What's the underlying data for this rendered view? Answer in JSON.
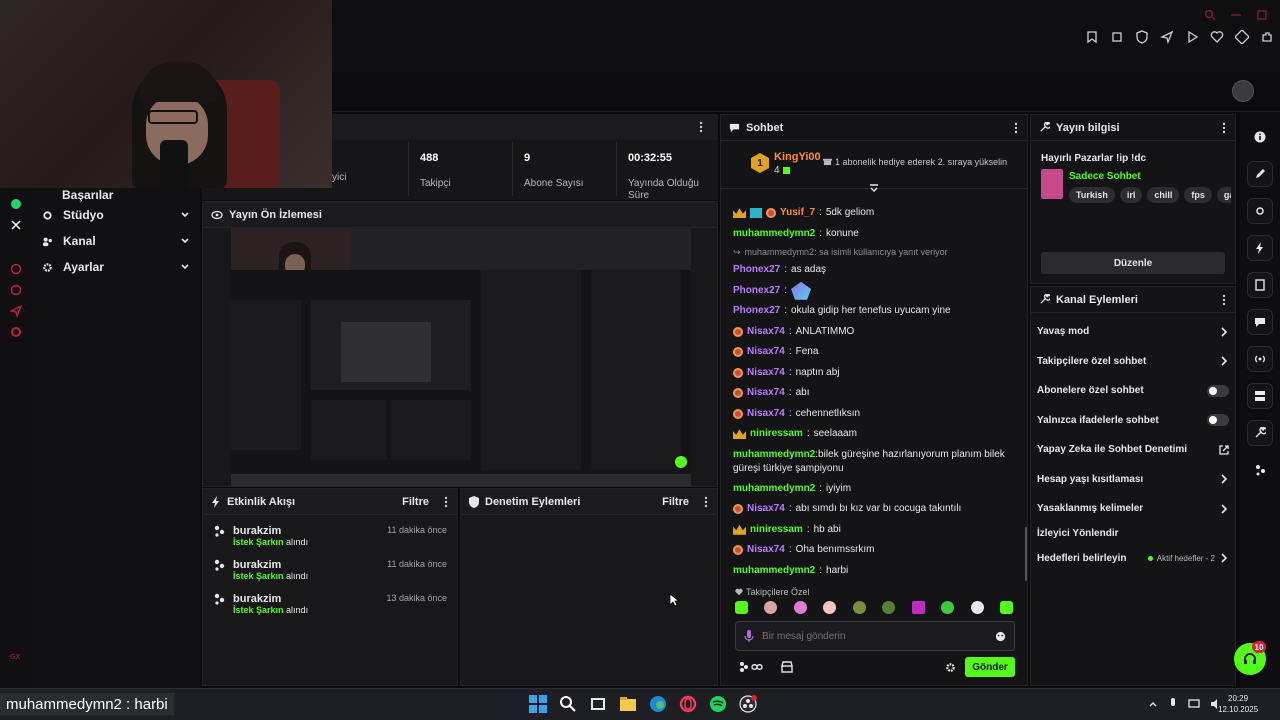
{
  "sidebar": {
    "partial_item": "Başarılar",
    "items": [
      {
        "label": "Stüdyo",
        "icon": "gear-icon"
      },
      {
        "label": "Kanal",
        "icon": "people-icon"
      },
      {
        "label": "Ayarlar",
        "icon": "gear-icon"
      }
    ]
  },
  "stats": {
    "partial_label": "yici",
    "items": [
      {
        "value": "488",
        "label": "Takipçi"
      },
      {
        "value": "9",
        "label": "Abone Sayısı"
      },
      {
        "value": "00:32:55",
        "label": "Yayında Olduğu Süre"
      }
    ]
  },
  "preview": {
    "title": "Yayın Ön İzlemesi"
  },
  "activity": {
    "title": "Etkinlik Akışı",
    "filter": "Filtre",
    "rows": [
      {
        "user": "burakzim",
        "item": "İstek Şarkın",
        "action": "alındı",
        "time": "11 dakika önce"
      },
      {
        "user": "burakzim",
        "item": "İstek Şarkın",
        "action": "alındı",
        "time": "11 dakika önce"
      },
      {
        "user": "burakzim",
        "item": "İstek Şarkın",
        "action": "alındı",
        "time": "13 dakika önce"
      }
    ]
  },
  "moderation": {
    "title": "Denetim Eylemleri",
    "filter": "Filtre"
  },
  "chat": {
    "title": "Sohbet",
    "pinned_user": "KingYi00",
    "pinned_rank": "1",
    "pinned_count": "4",
    "pinned_text": "1 abonelik hediye ederek 2. sıraya yükselin",
    "messages": [
      {
        "user": "Yusif_7",
        "text": "5dk geliom",
        "color": "orange",
        "badges": "crown-sub"
      },
      {
        "user": "muhammedymn2",
        "text": "konune",
        "color": "green"
      },
      {
        "reply": "muhammedymn2: sa isimli kullanıcıya yanıt veriyor"
      },
      {
        "user": "Phonex27",
        "text": "as adaş",
        "color": "purple"
      },
      {
        "user": "Phonex27",
        "text": "",
        "color": "purple",
        "emote": true
      },
      {
        "user": "Phonex27",
        "text": "okula gidip her tenefus uyucam yine",
        "color": "purple"
      },
      {
        "user": "Nisax74",
        "text": "ANLATIMMO",
        "color": "purple",
        "badges": "dot"
      },
      {
        "user": "Nisax74",
        "text": "Fena",
        "color": "purple",
        "badges": "dot"
      },
      {
        "user": "Nisax74",
        "text": "naptın abj",
        "color": "purple",
        "badges": "dot"
      },
      {
        "user": "Nisax74",
        "text": "abı",
        "color": "purple",
        "badges": "dot"
      },
      {
        "user": "Nisax74",
        "text": "cehennetlıksın",
        "color": "purple",
        "badges": "dot"
      },
      {
        "user": "niniressam",
        "text": "seelaaam",
        "color": "green",
        "badges": "crown"
      },
      {
        "user": "muhammedymn2",
        "text": "bilek güreşine hazırlanıyorum planım bilek güreşi türkiye şampiyonu",
        "color": "green"
      },
      {
        "user": "muhammedymn2",
        "text": "iyiyim",
        "color": "green"
      },
      {
        "user": "Nisax74",
        "text": "abı sımdı bı kız var bı cocuga takıntılı",
        "color": "purple",
        "badges": "dot"
      },
      {
        "user": "niniressam",
        "text": "hb abi",
        "color": "green",
        "badges": "crown"
      },
      {
        "user": "Nisax74",
        "text": "Oha benımssrkım",
        "color": "purple",
        "badges": "dot"
      },
      {
        "user": "muhammedymn2",
        "text": "harbi",
        "color": "green"
      }
    ],
    "followers_only": "Takipçilere Özel",
    "input_placeholder": "Bir mesaj gönderin",
    "send": "Gönder"
  },
  "stream_info": {
    "title": "Yayın bilgisi",
    "stream_title": "Hayırlı Pazarlar !ip !dc",
    "category": "Sadece Sohbet",
    "tags": [
      "Turkish",
      "irl",
      "chill",
      "fps",
      "gamin"
    ],
    "edit": "Düzenle"
  },
  "channel_actions": {
    "title": "Kanal Eylemleri",
    "items": [
      {
        "label": "Yavaş mod",
        "control": "chevron"
      },
      {
        "label": "Takipçilere özel sohbet",
        "control": "chevron"
      },
      {
        "label": "Abonelere özel sohbet",
        "control": "toggle"
      },
      {
        "label": "Yalnızca ifadelerle sohbet",
        "control": "toggle"
      },
      {
        "label": "Yapay Zeka ile Sohbet Denetimi",
        "control": "external"
      },
      {
        "label": "Hesap yaşı kısıtlaması",
        "control": "chevron"
      },
      {
        "label": "Yasaklanmış kelimeler",
        "control": "chevron"
      },
      {
        "label": "İzleyici Yönlendir",
        "control": "none"
      },
      {
        "label": "Hedefleri belirleyin",
        "control": "chevron",
        "status": "Aktif hedefler - 2"
      }
    ]
  },
  "help_badge": "10",
  "taskbar": {
    "overlay_text": "muhammedymn2 : harbi",
    "time": "20:29",
    "date": "12.10.2025"
  },
  "colors": {
    "accent": "#53fc18",
    "panel": "#18181b",
    "background": "#0b0b0d"
  }
}
